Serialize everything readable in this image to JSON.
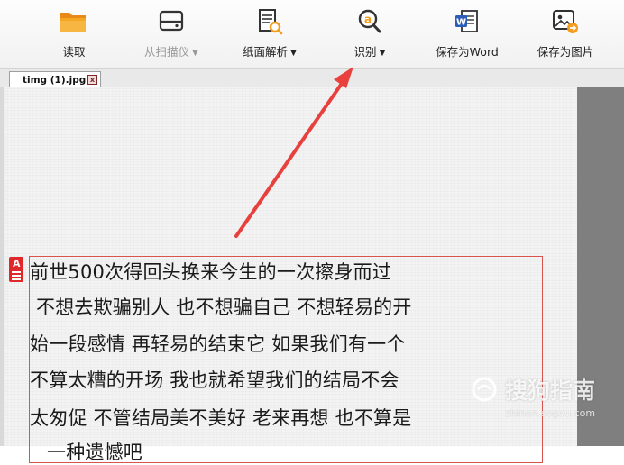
{
  "toolbar": {
    "items": [
      {
        "label": "读取",
        "icon": "open-folder-icon",
        "disabled": false,
        "has_dropdown": false
      },
      {
        "label": "从扫描仪",
        "icon": "scanner-icon",
        "disabled": true,
        "has_dropdown": true
      },
      {
        "label": "纸面解析",
        "icon": "page-analysis-icon",
        "disabled": false,
        "has_dropdown": true
      },
      {
        "label": "识别",
        "icon": "recognize-icon",
        "disabled": false,
        "has_dropdown": true
      },
      {
        "label": "保存为Word",
        "icon": "word-icon",
        "disabled": false,
        "has_dropdown": false
      },
      {
        "label": "保存为图片",
        "icon": "save-image-icon",
        "disabled": false,
        "has_dropdown": false
      }
    ],
    "caret": "▼"
  },
  "tabs": [
    {
      "title": "timg (1).jpg",
      "close": "x"
    }
  ],
  "document": {
    "ocr_marker": "A",
    "lines": [
      "前世500次得回头换来今生的一次擦身而过",
      "不想去欺骗别人 也不想骗自己 不想轻易的开",
      "始一段感情 再轻易的结束它 如果我们有一个",
      "不算太糟的开场 我也就希望我们的结局不会",
      "太匆促 不管结局美不美好 老来再想 也不算是",
      "一种遗憾吧"
    ]
  },
  "watermark": {
    "text": "搜狗指南",
    "url": "zhinan.sogou.com"
  },
  "colors": {
    "accent_orange": "#f39c1d",
    "marker_red": "#e0282a",
    "arrow_red": "#e8403c",
    "disabled_text": "#9a9a9a"
  }
}
